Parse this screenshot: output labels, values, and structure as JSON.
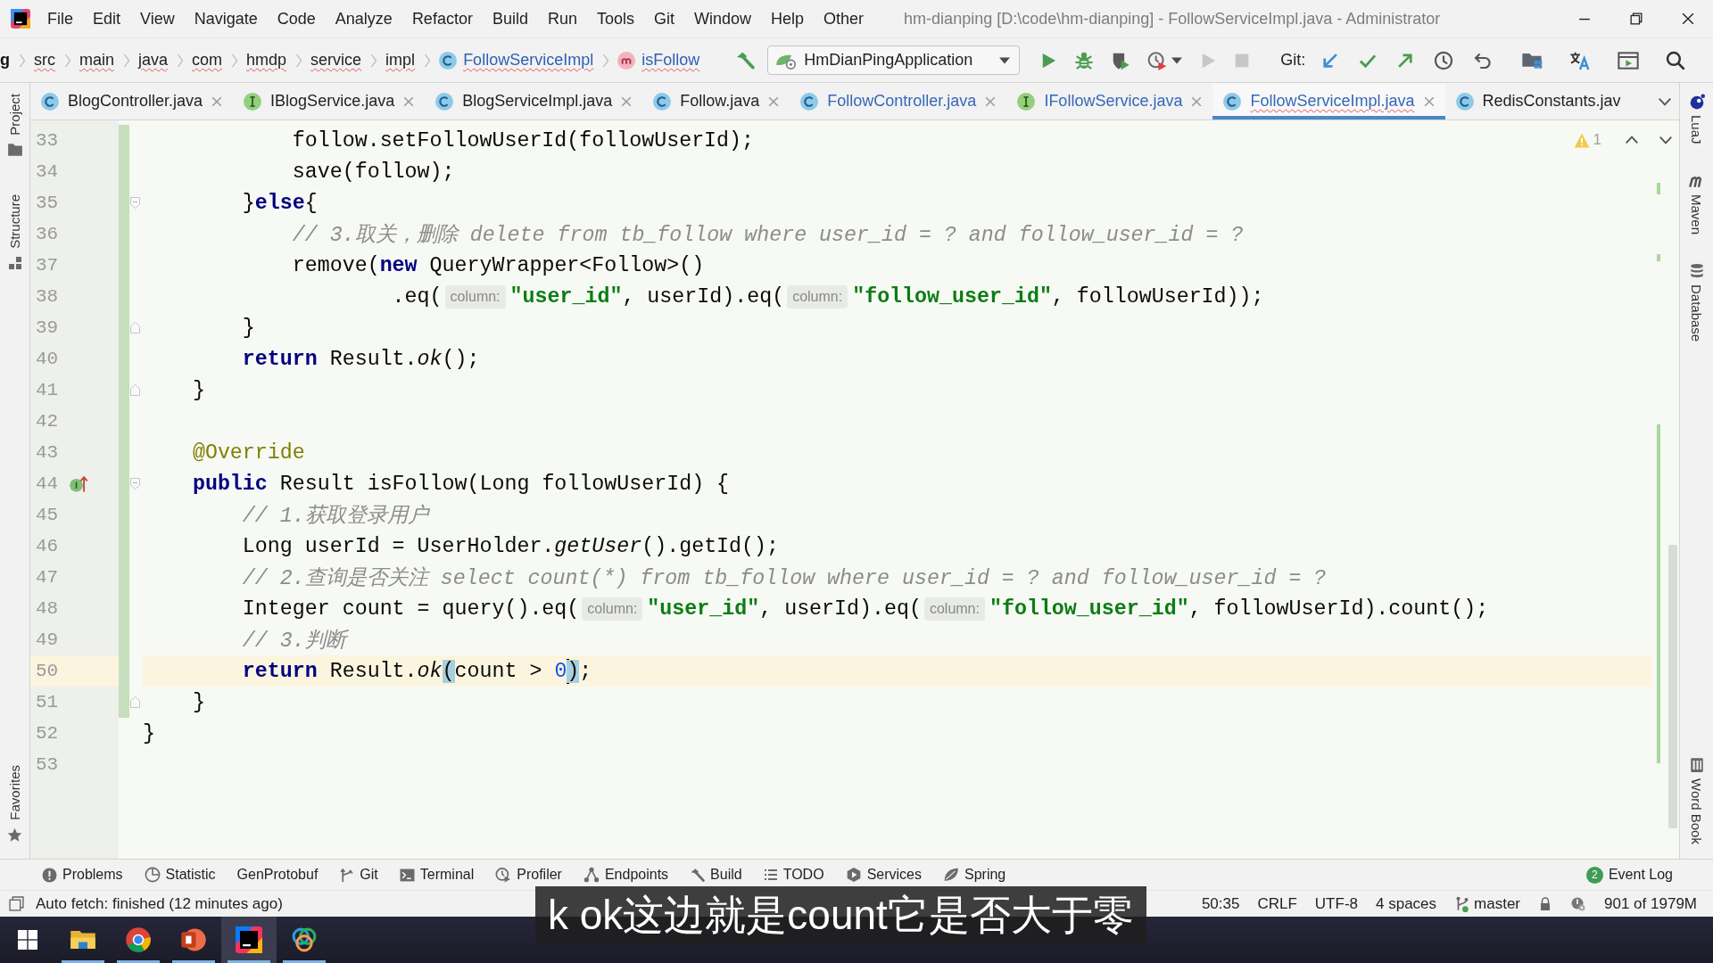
{
  "title_bar": {
    "menus": [
      "File",
      "Edit",
      "View",
      "Navigate",
      "Code",
      "Analyze",
      "Refactor",
      "Build",
      "Run",
      "Tools",
      "Git",
      "Window",
      "Help",
      "Other"
    ],
    "title": "hm-dianping [D:\\code\\hm-dianping] - FollowServiceImpl.java - Administrator"
  },
  "nav_bar": {
    "breadcrumbs": [
      {
        "label": "g",
        "kind": "root",
        "problems": false
      },
      {
        "label": "src",
        "kind": "plain",
        "problems": true
      },
      {
        "label": "main",
        "kind": "plain",
        "problems": true
      },
      {
        "label": "java",
        "kind": "plain",
        "problems": true
      },
      {
        "label": "com",
        "kind": "plain",
        "problems": true
      },
      {
        "label": "hmdp",
        "kind": "plain",
        "problems": true
      },
      {
        "label": "service",
        "kind": "plain",
        "problems": true
      },
      {
        "label": "impl",
        "kind": "plain",
        "problems": true
      },
      {
        "label": "FollowServiceImpl",
        "kind": "class",
        "problems": true
      },
      {
        "label": "isFollow",
        "kind": "method",
        "problems": true
      }
    ],
    "run_configuration": "HmDianPingApplication",
    "vcs_label": "Git:"
  },
  "left_strip": {
    "top": [
      {
        "label": "Project",
        "kind": "folder"
      },
      {
        "label": "Structure",
        "kind": "structure"
      }
    ],
    "bottom": [
      {
        "label": "Favorites",
        "kind": "star"
      }
    ]
  },
  "tabs": [
    {
      "label": "BlogController.java",
      "kind": "class",
      "modified": false,
      "problems": false,
      "closable": true,
      "selected": false
    },
    {
      "label": "IBlogService.java",
      "kind": "interface",
      "modified": false,
      "problems": false,
      "closable": true,
      "selected": false
    },
    {
      "label": "BlogServiceImpl.java",
      "kind": "class",
      "modified": false,
      "problems": false,
      "closable": true,
      "selected": false
    },
    {
      "label": "Follow.java",
      "kind": "class",
      "modified": false,
      "problems": false,
      "closable": true,
      "selected": false
    },
    {
      "label": "FollowController.java",
      "kind": "class",
      "modified": true,
      "problems": false,
      "closable": true,
      "selected": false
    },
    {
      "label": "IFollowService.java",
      "kind": "interface",
      "modified": true,
      "problems": false,
      "closable": true,
      "selected": false
    },
    {
      "label": "FollowServiceImpl.java",
      "kind": "class",
      "modified": true,
      "problems": true,
      "closable": true,
      "selected": true
    },
    {
      "label": "RedisConstants.jav",
      "kind": "class",
      "modified": false,
      "problems": false,
      "closable": false,
      "selected": false
    }
  ],
  "editor": {
    "problems_count": "1",
    "lines": [
      {
        "number": "33",
        "changed": true,
        "current": false,
        "tokens": [
          {
            "kind": "plain",
            "text": "            follow.setFollowUserId(followUserId);"
          }
        ]
      },
      {
        "number": "34",
        "changed": true,
        "current": false,
        "tokens": [
          {
            "kind": "plain",
            "text": "            save(follow);"
          }
        ]
      },
      {
        "number": "35",
        "changed": true,
        "current": false,
        "markers": [
          {
            "kind": "fold_start"
          }
        ],
        "tokens": [
          {
            "kind": "plain",
            "text": "        }"
          },
          {
            "kind": "keyword",
            "text": "else"
          },
          {
            "kind": "plain",
            "text": "{"
          }
        ]
      },
      {
        "number": "36",
        "changed": true,
        "current": false,
        "tokens": [
          {
            "kind": "comment",
            "text": "            // 3.取关，删除 delete from tb_follow where user_id = ? and follow_user_id = ?"
          }
        ]
      },
      {
        "number": "37",
        "changed": true,
        "current": false,
        "tokens": [
          {
            "kind": "plain",
            "text": "            remove("
          },
          {
            "kind": "keyword",
            "text": "new"
          },
          {
            "kind": "plain",
            "text": " QueryWrapper<Follow>()"
          }
        ]
      },
      {
        "number": "38",
        "changed": true,
        "current": false,
        "tokens": [
          {
            "kind": "plain",
            "text": "                    .eq("
          },
          {
            "kind": "hint",
            "text": "column:"
          },
          {
            "kind": "string",
            "text": "\"user_id\""
          },
          {
            "kind": "plain",
            "text": ", userId).eq("
          },
          {
            "kind": "hint",
            "text": "column:"
          },
          {
            "kind": "string",
            "text": "\"follow_user_id\""
          },
          {
            "kind": "plain",
            "text": ", followUserId));"
          }
        ]
      },
      {
        "number": "39",
        "changed": true,
        "current": false,
        "markers": [
          {
            "kind": "fold_end"
          }
        ],
        "tokens": [
          {
            "kind": "plain",
            "text": "        }"
          }
        ]
      },
      {
        "number": "40",
        "changed": true,
        "current": false,
        "tokens": [
          {
            "kind": "keyword",
            "text": "        return"
          },
          {
            "kind": "plain",
            "text": " Result."
          },
          {
            "kind": "static_call",
            "text": "ok"
          },
          {
            "kind": "plain",
            "text": "();"
          }
        ]
      },
      {
        "number": "41",
        "changed": true,
        "current": false,
        "markers": [
          {
            "kind": "fold_end"
          }
        ],
        "tokens": [
          {
            "kind": "plain",
            "text": "    }"
          }
        ]
      },
      {
        "number": "42",
        "changed": true,
        "current": false
      },
      {
        "number": "43",
        "changed": true,
        "current": false,
        "tokens": [
          {
            "kind": "annotation",
            "text": "    @Override"
          }
        ]
      },
      {
        "number": "44",
        "changed": true,
        "current": false,
        "markers": [
          {
            "kind": "implements"
          },
          {
            "kind": "fold_start"
          }
        ],
        "tokens": [
          {
            "kind": "keyword",
            "text": "    public"
          },
          {
            "kind": "plain",
            "text": " Result isFollow(Long followUserId) {"
          }
        ]
      },
      {
        "number": "45",
        "changed": true,
        "current": false,
        "tokens": [
          {
            "kind": "comment",
            "text": "        // 1.获取登录用户"
          }
        ]
      },
      {
        "number": "46",
        "changed": true,
        "current": false,
        "tokens": [
          {
            "kind": "plain",
            "text": "        Long userId = UserHolder."
          },
          {
            "kind": "static_call",
            "text": "getUser"
          },
          {
            "kind": "plain",
            "text": "().getId();"
          }
        ]
      },
      {
        "number": "47",
        "changed": true,
        "current": false,
        "tokens": [
          {
            "kind": "comment",
            "text": "        // 2.查询是否关注 select count(*) from tb_follow where user_id = ? and follow_user_id = ?"
          }
        ]
      },
      {
        "number": "48",
        "changed": true,
        "current": false,
        "tokens": [
          {
            "kind": "plain",
            "text": "        Integer count = query().eq("
          },
          {
            "kind": "hint",
            "text": "column:"
          },
          {
            "kind": "string",
            "text": "\"user_id\""
          },
          {
            "kind": "plain",
            "text": ", userId).eq("
          },
          {
            "kind": "hint",
            "text": "column:"
          },
          {
            "kind": "string",
            "text": "\"follow_user_id\""
          },
          {
            "kind": "plain",
            "text": ", followUserId).count();"
          }
        ]
      },
      {
        "number": "49",
        "changed": true,
        "current": false,
        "tokens": [
          {
            "kind": "comment",
            "text": "        // 3.判断"
          }
        ]
      },
      {
        "number": "50",
        "changed": true,
        "current": true,
        "tokens": [
          {
            "kind": "keyword",
            "text": "        return"
          },
          {
            "kind": "plain",
            "text": " Result."
          },
          {
            "kind": "static_call",
            "text": "ok"
          },
          {
            "kind": "brace_match",
            "text": "("
          },
          {
            "kind": "plain",
            "text": "count > "
          },
          {
            "kind": "number",
            "text": "0",
            "caret_after": true
          },
          {
            "kind": "brace_match",
            "text": ")"
          },
          {
            "kind": "plain",
            "text": ";"
          }
        ]
      },
      {
        "number": "51",
        "changed": true,
        "current": false,
        "markers": [
          {
            "kind": "fold_end"
          }
        ],
        "tokens": [
          {
            "kind": "plain",
            "text": "    }"
          }
        ]
      },
      {
        "number": "52",
        "changed": false,
        "current": false,
        "tokens": [
          {
            "kind": "plain",
            "text": "}"
          }
        ]
      },
      {
        "number": "53",
        "changed": false,
        "current": false
      }
    ]
  },
  "right_strip": {
    "top": [
      {
        "label": "LuaJ",
        "kind": "luaj"
      },
      {
        "label": "Maven",
        "kind": "maven"
      },
      {
        "label": "Database",
        "kind": "database"
      }
    ],
    "bottom": [
      {
        "label": "Word Book",
        "kind": "book"
      }
    ]
  },
  "tool_windows": {
    "items": [
      {
        "label": "Problems",
        "kind": "problems"
      },
      {
        "label": "Statistic",
        "kind": "statistic"
      },
      {
        "label": "GenProtobuf",
        "kind": "plain"
      },
      {
        "label": "Git",
        "kind": "git"
      },
      {
        "label": "Terminal",
        "kind": "terminal"
      },
      {
        "label": "Profiler",
        "kind": "profiler"
      },
      {
        "label": "Endpoints",
        "kind": "endpoints"
      },
      {
        "label": "Build",
        "kind": "build"
      },
      {
        "label": "TODO",
        "kind": "todo"
      },
      {
        "label": "Services",
        "kind": "services"
      },
      {
        "label": "Spring",
        "kind": "spring"
      }
    ],
    "event_log": {
      "label": "Event Log",
      "count": "2"
    }
  },
  "status_bar": {
    "message": "Auto fetch: finished (12 minutes ago)",
    "caret_position": "50:35",
    "line_separator": "CRLF",
    "encoding": "UTF-8",
    "indentation": "4 spaces",
    "branch": "master",
    "memory": "901 of 1979M"
  },
  "taskbar": [
    {
      "kind": "start",
      "running": false,
      "selected": false
    },
    {
      "kind": "folder",
      "running": true,
      "selected": false
    },
    {
      "kind": "browser",
      "running": true,
      "selected": false
    },
    {
      "kind": "slides",
      "running": true,
      "selected": false
    },
    {
      "kind": "ide",
      "running": true,
      "selected": true
    },
    {
      "kind": "rings",
      "running": true,
      "selected": false
    }
  ],
  "subtitle": "k ok这边就是count它是否大于零"
}
